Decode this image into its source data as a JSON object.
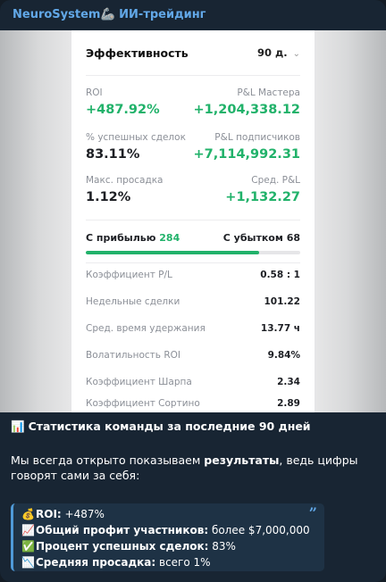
{
  "channel": {
    "name": "NeuroSystem",
    "emoji": "🦾",
    "name_suffix": "ИИ-трейдинг"
  },
  "card": {
    "title": "Эффективность",
    "period": "90 д.",
    "metrics": {
      "roi": {
        "label": "ROI",
        "value": "+487.92%"
      },
      "pl_master": {
        "label": "P&L Мастера",
        "value": "+1,204,338.12"
      },
      "success_rate": {
        "label": "% успешных сделок",
        "value": "83.11%"
      },
      "pl_subscribers": {
        "label": "P&L подписчиков",
        "value": "+7,114,992.31"
      },
      "max_drawdown": {
        "label": "Макс. просадка",
        "value": "1.12%"
      },
      "avg_pl": {
        "label": "Сред. P&L",
        "value": "+1,132.27"
      }
    },
    "profit_label": "С прибылью",
    "profit_count": "284",
    "loss_label": "С убытком",
    "loss_count": "68",
    "profit_ratio": 0.807,
    "stats": [
      {
        "label": "Коэффициент P/L",
        "value": "0.58 : 1"
      },
      {
        "label": "Недельные сделки",
        "value": "101.22"
      },
      {
        "label": "Сред. время удержания",
        "value": "13.77 ч"
      },
      {
        "label": "Волатильность ROI",
        "value": "9.84%"
      },
      {
        "label": "Коэффициент Шарпа",
        "value": "2.34"
      },
      {
        "label": "Коэффициент Сортино",
        "value": "2.89"
      }
    ]
  },
  "message": {
    "headline_emoji": "📊",
    "headline": "Статистика команды за последние 90 дней",
    "para_part1": "Мы всегда открыто показываем ",
    "para_bold": "результаты",
    "para_part2": ", ведь цифры говорят сами за себя:",
    "quote": [
      {
        "emoji": "💰",
        "label": "ROI:",
        "value": " +487%"
      },
      {
        "emoji": "📈",
        "label": "Общий профит участников:",
        "value": " более $7,000,000"
      },
      {
        "emoji": "✅",
        "label": "Процент успешных сделок:",
        "value": " 83%"
      },
      {
        "emoji": "📉",
        "label": "Средняя просадка:",
        "value": " всего 1%"
      }
    ]
  },
  "colors": {
    "accent": "#62a8e8",
    "profit_green": "#21b26a",
    "bubble_bg": "#182533"
  }
}
